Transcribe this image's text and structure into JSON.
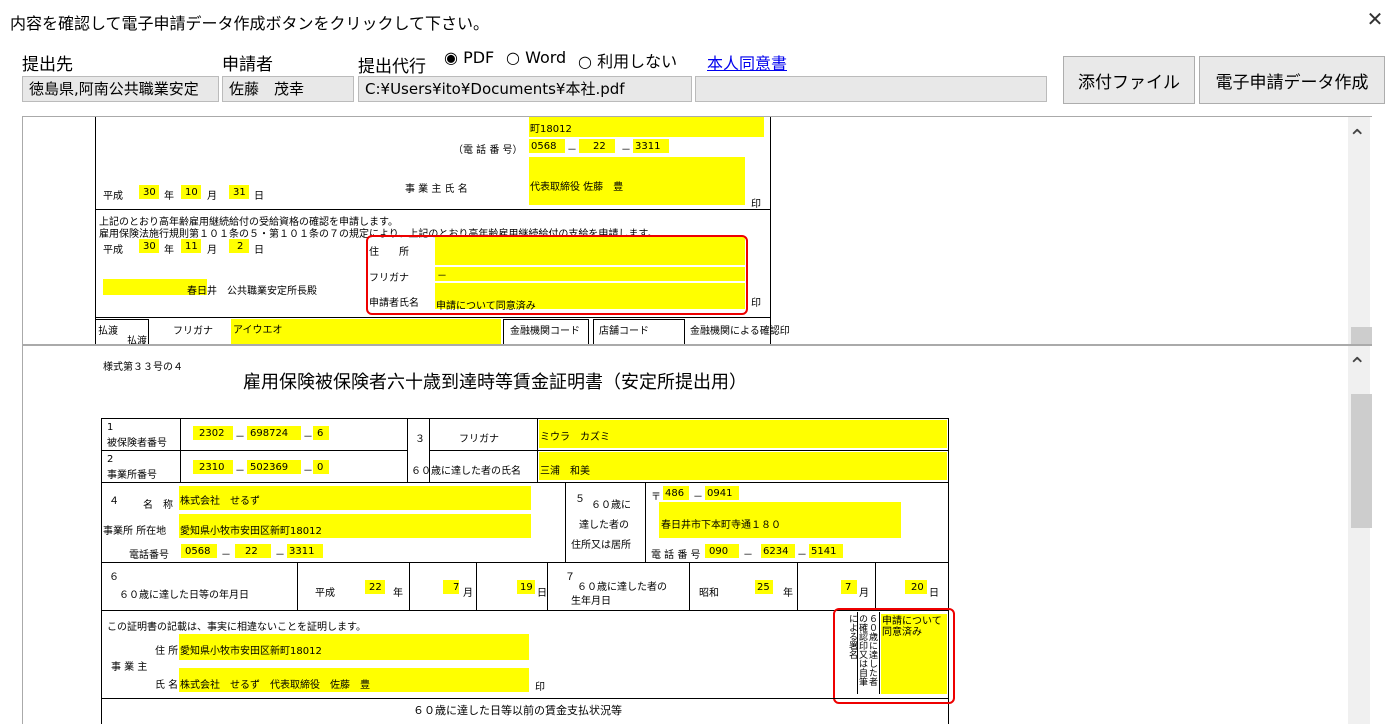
{
  "window": {
    "title": "内容を確認して電子申請データ作成ボタンをクリックして下さい。",
    "close_glyph": "✕"
  },
  "header": {
    "dest_label": "提出先",
    "applicant_label": "申請者",
    "proxy_label": "提出代行",
    "options": [
      "PDF",
      "Word",
      "利用しない"
    ],
    "selected_option": "PDF",
    "consent_link": "本人同意書",
    "dest_value": "徳島県,阿南公共職業安定",
    "applicant_value": "佐藤　茂幸",
    "path_value": "C:¥Users¥ito¥Documents¥本社.pdf",
    "extra_value": ""
  },
  "buttons": {
    "attach": "添付ファイル",
    "create": "電子申請データ作成"
  },
  "doc1": {
    "addr_tail": "町18012",
    "tel_label": "（電 話 番 号）",
    "tel1": "0568",
    "tel2": "22",
    "tel3": "3311",
    "era": "平成",
    "y1": "30",
    "nen": "年",
    "m1": "10",
    "tsuki": "月",
    "d1": "31",
    "hi": "日",
    "owner_label": "事 業 主 氏 名",
    "owner_value": "代表取締役 佐藤　豊",
    "seal": "印",
    "line1": "上記のとおり高年齢雇用継続給付の受給資格の確認を申請します。",
    "line2": "雇用保険法施行規則第１０１条の５・第１０１条の７の規定により、上記のとおり高年齢雇用継続給付の支給を申請します。",
    "y2": "30",
    "m2": "11",
    "d2": "2",
    "office": "春日井",
    "office_suffix": "公共職業安定所長殿",
    "addr_label": "住　　所",
    "kana_label": "フリガナ",
    "kana_value": "－",
    "name_label": "申請者氏名",
    "name_value": "申請について同意済み",
    "bank_a": "払渡",
    "bank_b": "払渡",
    "bank_kana": "フリガナ",
    "bank_kana_value": "アイウエオ",
    "bank_code": "金融機関コード",
    "branch_code": "店舗コード",
    "bank_confirm": "金融機関による確認印"
  },
  "doc2": {
    "form_no": "様式第３３号の４",
    "title": "雇用保険被保険者六十歳到達時等賃金証明書（安定所提出用）",
    "r1_label_no": "1",
    "r1_label": "被保険者番号",
    "ins1": "2302",
    "ins2": "698724",
    "ins3": "6",
    "r2_label_no": "2",
    "r2_label": "事業所番号",
    "off1": "2310",
    "off2": "502369",
    "off3": "0",
    "c3_no": "３",
    "c3_kana_label": "フリガナ",
    "c3_kana_value": "ミウラ　カズミ",
    "c3_name_label": "６０歳に達した者の氏名",
    "c3_name_value": "三浦　和美",
    "c4_no": "４",
    "c4_name_label": "名　称",
    "c4_name_value": "株式会社　せるず",
    "c4_addr_label": "事業所 所在地",
    "c4_addr_value": "愛知県小牧市安田区新町18012",
    "c4_tel_label": "電話番号",
    "c4_tel1": "0568",
    "c4_tel2": "22",
    "c4_tel3": "3311",
    "c5_no": "５",
    "c5_l1": "６０歳に",
    "c5_l2": "達した者の",
    "c5_l3": "住所又は居所",
    "zip_mark": "〒",
    "zip1": "486",
    "zip2": "0941",
    "c5_addr": "春日井市下本町寺通１８０",
    "c5_tel_label": "電 話 番 号",
    "c5_tel1": "090",
    "c5_tel2": "6234",
    "c5_tel3": "5141",
    "c6_no": "６",
    "c6_label": "６０歳に達した日等の年月日",
    "c6_era": "平成",
    "c6_y": "22",
    "c6_m": "7",
    "c6_d": "19",
    "c7_no": "７",
    "c7_label1": "６０歳に達した者の",
    "c7_label2": "生年月日",
    "c7_era": "昭和",
    "c7_y": "25",
    "c7_m": "7",
    "c7_d": "20",
    "nen": "年",
    "tsuki": "月",
    "hi": "日",
    "cert_line": "この証明書の記載は、事実に相違ないことを証明します。",
    "emp_addr_label": "住 所",
    "emp_addr_value": "愛知県小牧市安田区新町18012",
    "emp_label": "事 業 主",
    "emp_name_label": "氏 名",
    "emp_name_value": "株式会社　せるず　代表取締役　佐藤　豊",
    "seal": "印",
    "side_label": "６０歳に達した者の確認印又は自筆による署名",
    "side_value": "申請について同意済み",
    "wage_title": "６０歳に達した日等以前の賃金支払状況等",
    "dash": "－"
  }
}
